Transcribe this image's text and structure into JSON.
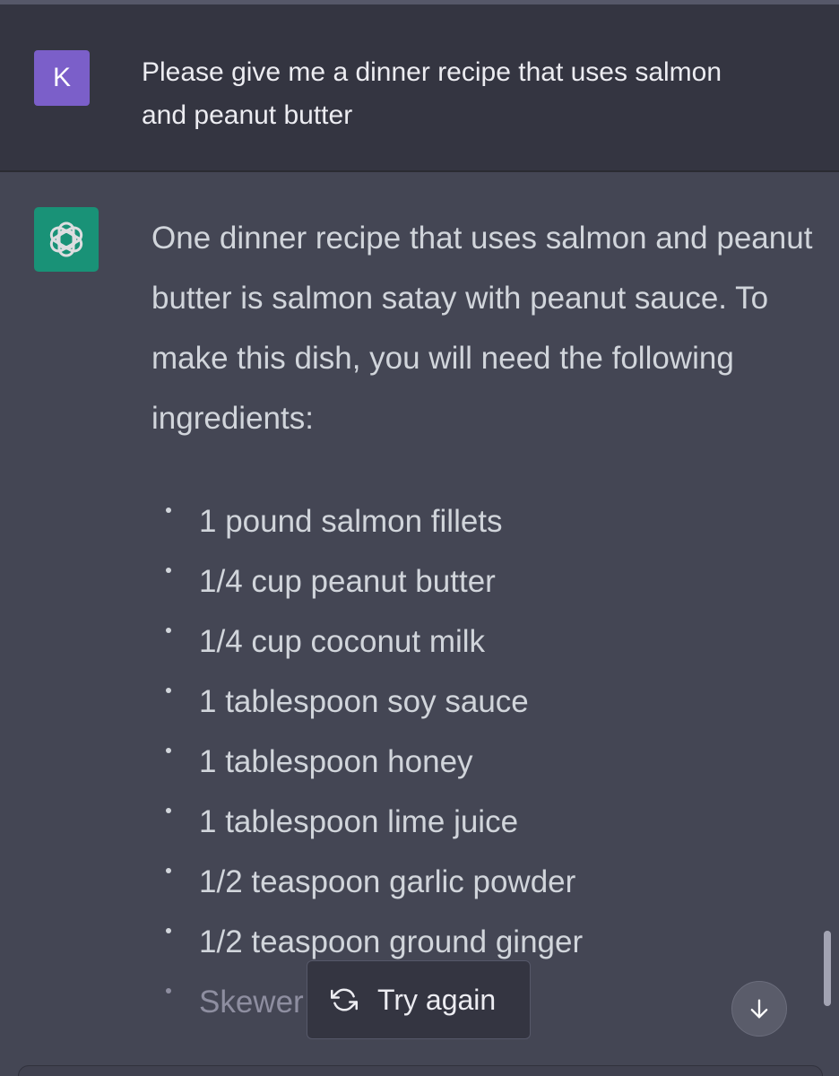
{
  "user_message": {
    "avatar_letter": "K",
    "text": "Please give me a dinner recipe that uses salmon and peanut butter",
    "avatar_color": "#7b5fc9"
  },
  "assistant_message": {
    "avatar_icon": "openai-logo-icon",
    "avatar_color": "#10a37f",
    "intro": "One dinner recipe that uses salmon and peanut butter is salmon satay with peanut sauce. To make this dish, you will need the following ingredients:",
    "ingredients": [
      "1 pound salmon fillets",
      "1/4 cup peanut butter",
      "1/4 cup coconut milk",
      "1 tablespoon soy sauce",
      "1 tablespoon honey",
      "1 tablespoon lime juice",
      "1/2 teaspoon garlic powder",
      "1/2 teaspoon ground ginger",
      "Skewer"
    ]
  },
  "actions": {
    "try_again_label": "Try again",
    "try_again_icon": "refresh-icon",
    "scroll_down_icon": "arrow-down-icon"
  }
}
